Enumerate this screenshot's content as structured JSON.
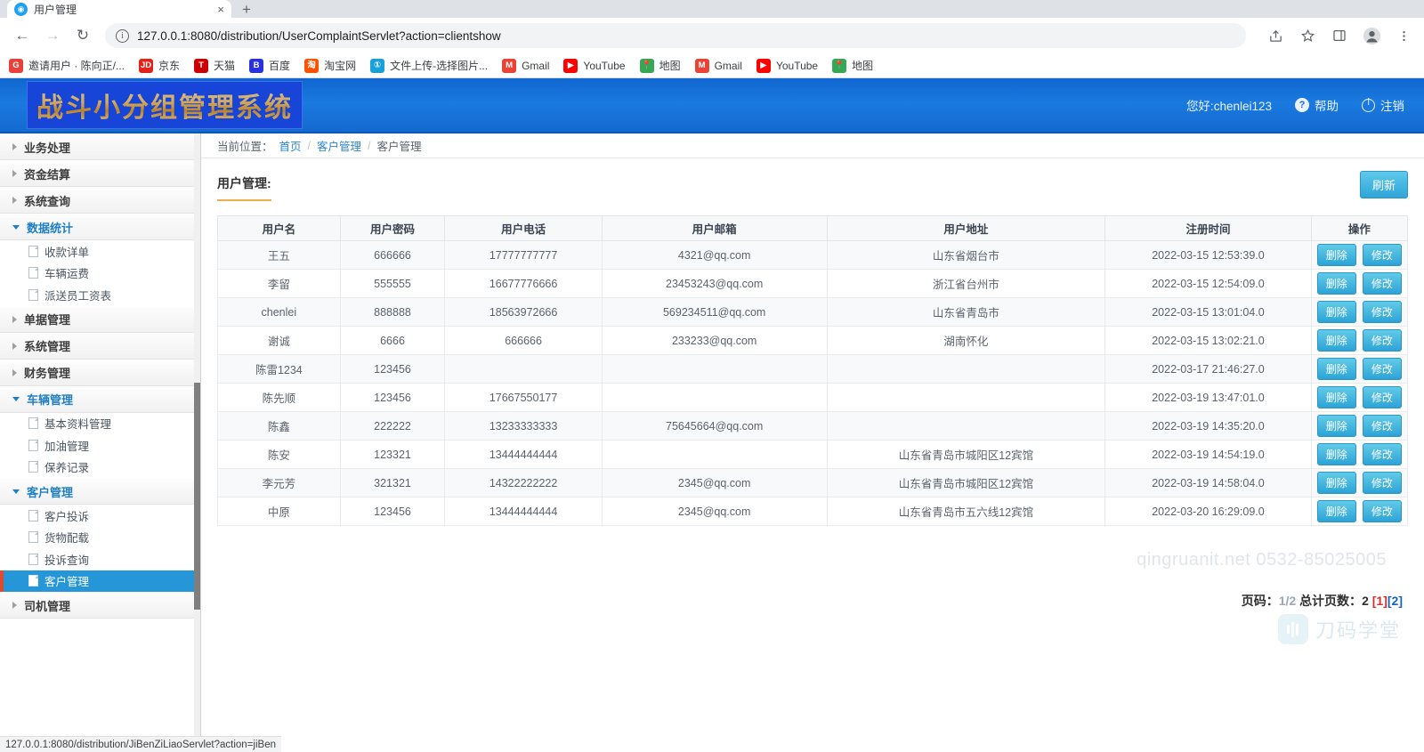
{
  "browser": {
    "tab": {
      "title": "用户管理",
      "favicon": "globe-icon",
      "close": "×"
    },
    "newtab_label": "+",
    "nav": {
      "back": "←",
      "forward": "→",
      "reload": "↻"
    },
    "omnibox": {
      "info_icon": "ⓘ",
      "url": "127.0.0.1:8080/distribution/UserComplaintServlet?action=clientshow"
    },
    "toolbar_icons": [
      "share-icon",
      "star-icon",
      "sidepanel-icon",
      "profile-icon",
      "menu-icon"
    ],
    "bookmarks": [
      {
        "label": "邀请用户 · 陈向正/...",
        "icon_text": "G",
        "icon_color": "#e8403a"
      },
      {
        "label": "京东",
        "icon_text": "JD",
        "icon_color": "#e2231a"
      },
      {
        "label": "天猫",
        "icon_text": "T",
        "icon_color": "#cc0000"
      },
      {
        "label": "百度",
        "icon_text": "B",
        "icon_color": "#2932e1"
      },
      {
        "label": "淘宝网",
        "icon_text": "淘",
        "icon_color": "#ff5000"
      },
      {
        "label": "文件上传-选择图片...",
        "icon_text": "①",
        "icon_color": "#1aa0d8"
      },
      {
        "label": "Gmail",
        "icon_text": "M",
        "icon_color": "#ea4335"
      },
      {
        "label": "YouTube",
        "icon_text": "▶",
        "icon_color": "#ff0000"
      },
      {
        "label": "地图",
        "icon_text": "📍",
        "icon_color": "#34a853"
      },
      {
        "label": "Gmail",
        "icon_text": "M",
        "icon_color": "#ea4335"
      },
      {
        "label": "YouTube",
        "icon_text": "▶",
        "icon_color": "#ff0000"
      },
      {
        "label": "地图",
        "icon_text": "📍",
        "icon_color": "#34a853"
      }
    ],
    "status_bar": "127.0.0.1:8080/distribution/JiBenZiLiaoServlet?action=jiBen"
  },
  "app": {
    "logo_title": "战斗小分组管理系统",
    "header": {
      "greeting": "您好:chenlei123",
      "help_label": "帮助",
      "help_icon": "?",
      "logout_label": "注销"
    },
    "sidebar": [
      {
        "type": "group",
        "label": "业务处理",
        "open": false
      },
      {
        "type": "group",
        "label": "资金结算",
        "open": false
      },
      {
        "type": "group",
        "label": "系统查询",
        "open": false
      },
      {
        "type": "group",
        "label": "数据统计",
        "open": true
      },
      {
        "type": "item",
        "label": "收款详单",
        "active": false
      },
      {
        "type": "item",
        "label": "车辆运费",
        "active": false
      },
      {
        "type": "item",
        "label": "派送员工资表",
        "active": false
      },
      {
        "type": "group",
        "label": "单据管理",
        "open": false
      },
      {
        "type": "group",
        "label": "系统管理",
        "open": false
      },
      {
        "type": "group",
        "label": "财务管理",
        "open": false
      },
      {
        "type": "group",
        "label": "车辆管理",
        "open": true
      },
      {
        "type": "item",
        "label": "基本资料管理",
        "active": false
      },
      {
        "type": "item",
        "label": "加油管理",
        "active": false
      },
      {
        "type": "item",
        "label": "保养记录",
        "active": false
      },
      {
        "type": "group",
        "label": "客户管理",
        "open": true
      },
      {
        "type": "item",
        "label": "客户投诉",
        "active": false
      },
      {
        "type": "item",
        "label": "货物配载",
        "active": false
      },
      {
        "type": "item",
        "label": "投诉查询",
        "active": false
      },
      {
        "type": "item",
        "label": "客户管理",
        "active": true
      },
      {
        "type": "group",
        "label": "司机管理",
        "open": false
      }
    ],
    "breadcrumb": {
      "prefix": "当前位置：",
      "items": [
        "首页",
        "客户管理",
        "客户管理"
      ],
      "separator": "/"
    },
    "section": {
      "title": "用户管理:",
      "refresh_label": "刷新"
    },
    "table": {
      "columns": [
        "用户名",
        "用户密码",
        "用户电话",
        "用户邮箱",
        "用户地址",
        "注册时间",
        "操作"
      ],
      "action_labels": {
        "delete": "删除",
        "edit": "修改"
      },
      "rows": [
        {
          "name": "王五",
          "password": "666666",
          "phone": "17777777777",
          "email": "4321@qq.com",
          "address": "山东省烟台市",
          "registered": "2022-03-15 12:53:39.0"
        },
        {
          "name": "李留",
          "password": "555555",
          "phone": "16677776666",
          "email": "23453243@qq.com",
          "address": "浙江省台州市",
          "registered": "2022-03-15 12:54:09.0"
        },
        {
          "name": "chenlei",
          "password": "888888",
          "phone": "18563972666",
          "email": "569234511@qq.com",
          "address": "山东省青岛市",
          "registered": "2022-03-15 13:01:04.0"
        },
        {
          "name": "谢诚",
          "password": "6666",
          "phone": "666666",
          "email": "233233@qq.com",
          "address": "湖南怀化",
          "registered": "2022-03-15 13:02:21.0"
        },
        {
          "name": "陈雷1234",
          "password": "123456",
          "phone": "",
          "email": "",
          "address": "",
          "registered": "2022-03-17 21:46:27.0"
        },
        {
          "name": "陈先顺",
          "password": "123456",
          "phone": "17667550177",
          "email": "",
          "address": "",
          "registered": "2022-03-19 13:47:01.0"
        },
        {
          "name": "陈鑫",
          "password": "222222",
          "phone": "13233333333",
          "email": "75645664@qq.com",
          "address": "",
          "registered": "2022-03-19 14:35:20.0"
        },
        {
          "name": "陈安",
          "password": "123321",
          "phone": "13444444444",
          "email": "",
          "address": "山东省青岛市城阳区12宾馆",
          "registered": "2022-03-19 14:54:19.0"
        },
        {
          "name": "李元芳",
          "password": "321321",
          "phone": "14322222222",
          "email": "2345@qq.com",
          "address": "山东省青岛市城阳区12宾馆",
          "registered": "2022-03-19 14:58:04.0"
        },
        {
          "name": "中原",
          "password": "123456",
          "phone": "13444444444",
          "email": "2345@qq.com",
          "address": "山东省青岛市五六线12宾馆",
          "registered": "2022-03-20 16:29:09.0"
        }
      ]
    },
    "footer": {
      "watermark": "qingruanit.net 0532-85025005",
      "pager_prefix": "页码：",
      "pager_current": "1/2",
      "pager_total_label": "总计页数：",
      "pager_total": "2",
      "pager_page1": "[1]",
      "pager_page2": "[2]",
      "logo_name": "刀码学堂"
    }
  },
  "colors": {
    "accent_blue": "#1a7ae0",
    "button_cyan": "#2ba4d6",
    "active_item": "#2596d8",
    "underline_orange": "#f0ad4e",
    "pager_red": "#d32f2f"
  }
}
